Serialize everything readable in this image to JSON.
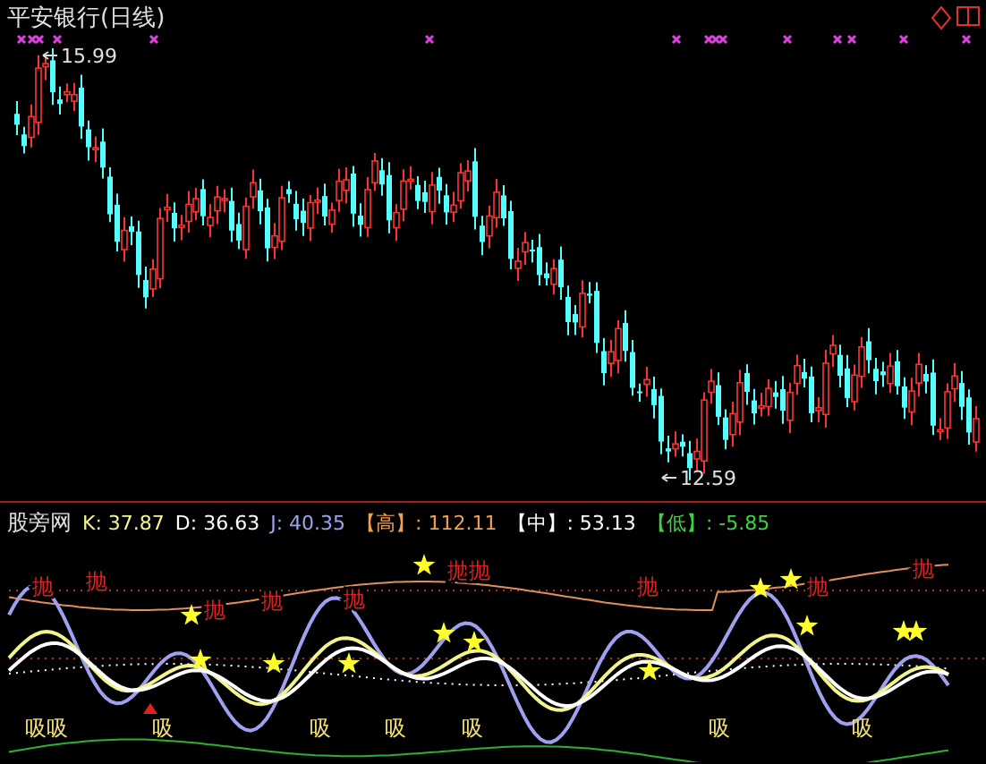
{
  "chart": {
    "title": "平安银行(日线)",
    "high_label": "15.99",
    "low_label": "12.59"
  },
  "indicator": {
    "name": "股旁网",
    "values": [
      {
        "label": "K:",
        "value": "37.87",
        "color": "#f4f48c"
      },
      {
        "label": "D:",
        "value": "36.63",
        "color": "#ffffff"
      },
      {
        "label": "J:",
        "value": "40.35",
        "color": "#a0a0f0"
      },
      {
        "label": "【高】:",
        "value": "112.11",
        "color": "#f0a050"
      },
      {
        "label": "【中】:",
        "value": "53.13",
        "color": "#ffffff"
      },
      {
        "label": "【低】:",
        "value": "-5.85",
        "color": "#40d040"
      }
    ],
    "sell_marks": [
      "抛",
      "抛",
      "抛",
      "抛",
      "抛",
      "抛",
      "抛",
      "抛",
      "抛",
      "抛"
    ],
    "buy_marks": [
      "吸",
      "吸",
      "吸",
      "吸",
      "吸",
      "吸",
      "吸",
      "吸"
    ]
  }
}
